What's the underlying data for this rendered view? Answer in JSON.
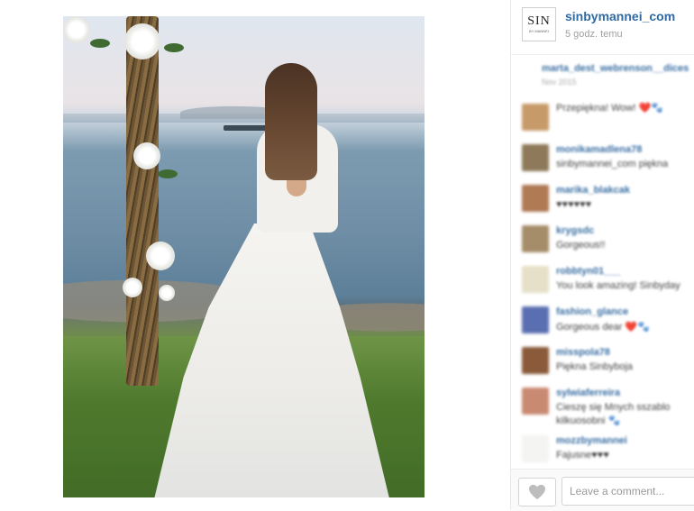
{
  "post": {
    "username": "sinbymannei_com",
    "time": "5 godz. temu",
    "avatar_logo": "SIN",
    "avatar_logo_sub": "BY MANNEI"
  },
  "comments": [
    {
      "user": "marta_dest_webrenson__dices",
      "text": "",
      "meta": "Nov 2015",
      "avatar_color": "#ffffff"
    },
    {
      "user": "",
      "text": "Przepiękna! Wow! ❤️🐾",
      "meta": "",
      "avatar_color": "#c79a6a"
    },
    {
      "user": "monikamadlena78",
      "text": "sinbymannei_com piękna",
      "meta": "",
      "avatar_color": "#8e7a5a"
    },
    {
      "user": "marika_blakcak",
      "text": "♥♥♥♥♥♥",
      "meta": "",
      "avatar_color": "#b07a55"
    },
    {
      "user": "krygsdc",
      "text": "Gorgeous!!",
      "meta": "",
      "avatar_color": "#a58d6a"
    },
    {
      "user": "robbtyn01___",
      "text": "You look amazing! Sinbyday",
      "meta": "",
      "avatar_color": "#e6e0c8"
    },
    {
      "user": "fashion_glance",
      "text": "Gorgeous dear ❤️🐾",
      "meta": "",
      "avatar_color": "#5a6fb2"
    },
    {
      "user": "misspola78",
      "text": "Piękna Sinbyboja",
      "meta": "",
      "avatar_color": "#8a5a3a"
    },
    {
      "user": "sylwiaferreira",
      "text": "Cieszę się Mnych sszablo",
      "meta": "kilkuosobni 🐾",
      "avatar_color": "#c98a72"
    },
    {
      "user": "mozzbymannei",
      "text": "Fajusne♥♥♥",
      "meta": "",
      "avatar_color": "#f4f4f2"
    }
  ],
  "footer": {
    "comment_placeholder": "Leave a comment...",
    "like_icon": "heart-icon"
  }
}
